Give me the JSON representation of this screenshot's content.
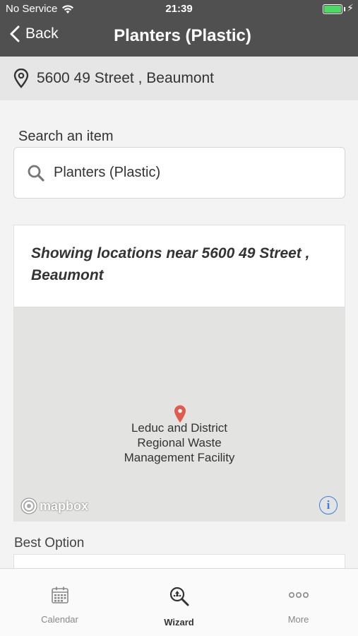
{
  "status_bar": {
    "carrier": "No Service",
    "time": "21:39",
    "battery_color": "#4cd964"
  },
  "nav": {
    "back_label": "Back",
    "title": "Planters (Plastic)"
  },
  "address": {
    "text": "5600 49 Street , Beaumont"
  },
  "search": {
    "label": "Search an item",
    "value": "Planters (Plastic)"
  },
  "results": {
    "heading": "Showing locations near 5600 49 Street , Beaumont",
    "map": {
      "marker_label": "Leduc and District Regional Waste Management Facility",
      "marker_color": "#e05a4e",
      "attribution": "mapbox",
      "info_icon": "info-icon"
    }
  },
  "best_option": {
    "label": "Best Option"
  },
  "tabs": [
    {
      "label": "Calendar",
      "icon": "calendar-icon",
      "active": false
    },
    {
      "label": "Wizard",
      "icon": "wizard-icon",
      "active": true
    },
    {
      "label": "More",
      "icon": "more-icon",
      "active": false
    }
  ]
}
